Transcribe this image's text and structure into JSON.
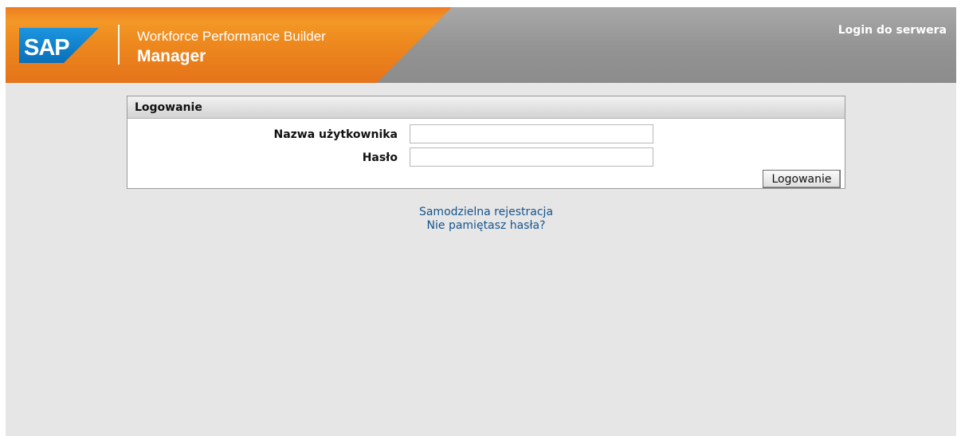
{
  "header": {
    "logo_text": "SAP",
    "product_line1": "Workforce Performance Builder",
    "product_line2": "Manager",
    "server_login_link": "Login do serwera",
    "brand_colors": {
      "orange": "#ee8a1e",
      "sap_blue": "#0a7ac6",
      "gray_bar": "#939393"
    }
  },
  "login_form": {
    "title": "Logowanie",
    "username_label": "Nazwa użytkownika",
    "username_value": "",
    "password_label": "Hasło",
    "password_value": "",
    "submit_label": "Logowanie"
  },
  "links": {
    "self_register": "Samodzielna rejestracja",
    "forgot_password": "Nie pamiętasz hasła?"
  },
  "colors": {
    "page_background": "#e6e6e6",
    "link": "#14548d"
  }
}
